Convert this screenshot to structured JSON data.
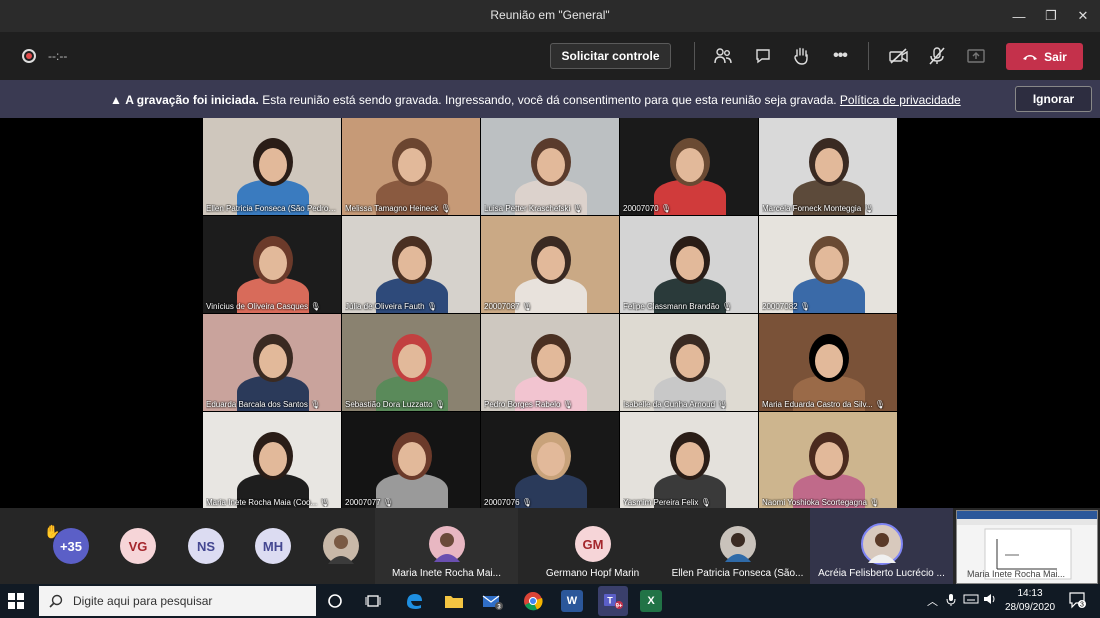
{
  "window": {
    "title": "Reunião em \"General\"",
    "minimize": "—",
    "restore": "❐",
    "close": "✕"
  },
  "toolbar": {
    "timer": "--:--",
    "request_control": "Solicitar controle",
    "more": "•••",
    "leave": "Sair"
  },
  "banner": {
    "bold": "A gravação foi iniciada.",
    "text": "Esta reunião está sendo gravada. Ingressando, você dá consentimento para que esta reunião seja gravada.",
    "link": "Política de privacidade",
    "ignore": "Ignorar"
  },
  "tiles": [
    {
      "name": "Ellen Patricia Fonseca (São Pedro..."
    },
    {
      "name": "Melissa Tamagno Heineck"
    },
    {
      "name": "Luisa Petter Kraschefski"
    },
    {
      "name": "20007070"
    },
    {
      "name": "Marcela Forneck Monteggia"
    },
    {
      "name": "Vinícius de Oliveira Casques"
    },
    {
      "name": "Júlia de Oliveira Fauth"
    },
    {
      "name": "20007087"
    },
    {
      "name": "Felipe Classmann Brandão"
    },
    {
      "name": "20007082"
    },
    {
      "name": "Eduarda Barcala dos Santos"
    },
    {
      "name": "Sebastião Dora Luzzatto"
    },
    {
      "name": "Pedro Borges Rabelo"
    },
    {
      "name": "Isabelle da Cunha Arnoud"
    },
    {
      "name": "Maria Eduarda Castro da Silv..."
    },
    {
      "name": "Maria Inete Rocha Maia (Coo..."
    },
    {
      "name": "20007077"
    },
    {
      "name": "20007076"
    },
    {
      "name": "Yasmim Pereira Felix"
    },
    {
      "name": "Naomi Yoshioka Scortegagna"
    }
  ],
  "strip": {
    "overflow": "+35",
    "initials": [
      "VG",
      "NS",
      "MH"
    ],
    "participants": [
      {
        "name": "Maria Inete Rocha Mai..."
      },
      {
        "name": "Germano Hopf Marin",
        "initials": "GM"
      },
      {
        "name": "Ellen Patricia Fonseca (São..."
      },
      {
        "name": "Acréia Felisberto Lucrécio ..."
      }
    ],
    "selfview_name": "Maria Inete Rocha Mai..."
  },
  "taskbar": {
    "search_placeholder": "Digite aqui para pesquisar",
    "time": "14:13",
    "date": "28/09/2020",
    "notification_count": "3"
  }
}
